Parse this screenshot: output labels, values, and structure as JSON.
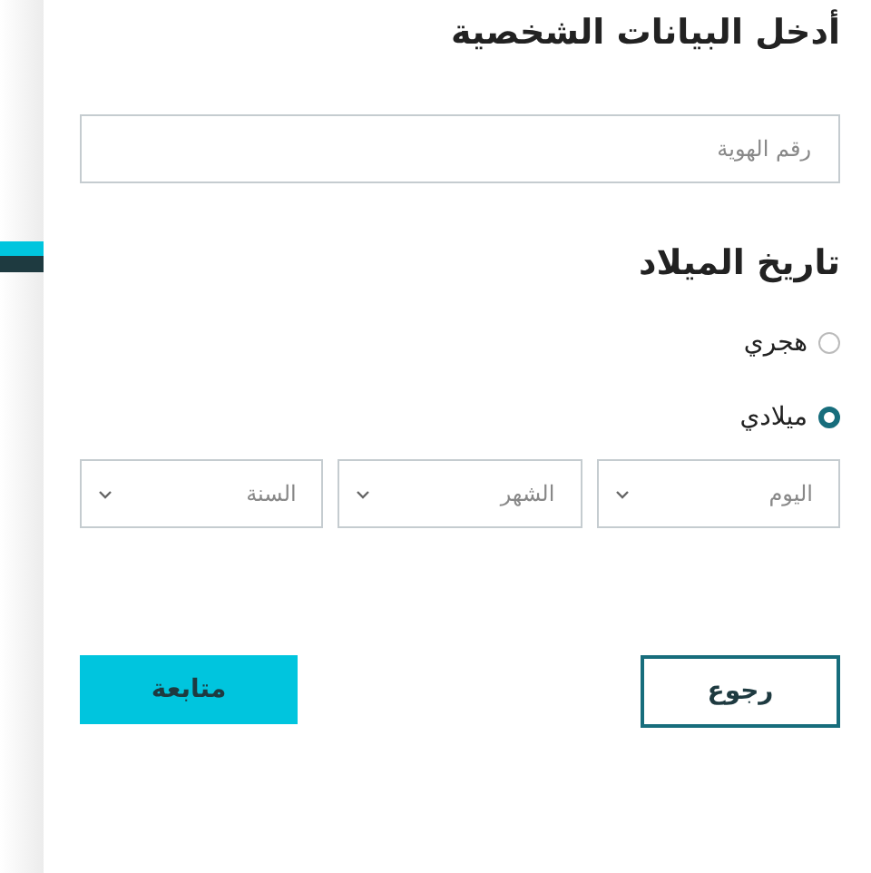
{
  "title": "أدخل البيانات الشخصية",
  "id_field": {
    "placeholder": "رقم الهوية"
  },
  "birth_date": {
    "title": "تاريخ الميلاد",
    "calendar_options": [
      {
        "label": "هجري",
        "selected": false
      },
      {
        "label": "ميلادي",
        "selected": true
      }
    ],
    "selects": [
      {
        "placeholder": "اليوم"
      },
      {
        "placeholder": "الشهر"
      },
      {
        "placeholder": "السنة"
      }
    ]
  },
  "buttons": [
    {
      "label": "رجوع",
      "kind": "secondary"
    },
    {
      "label": "متابعة",
      "kind": "primary"
    }
  ]
}
